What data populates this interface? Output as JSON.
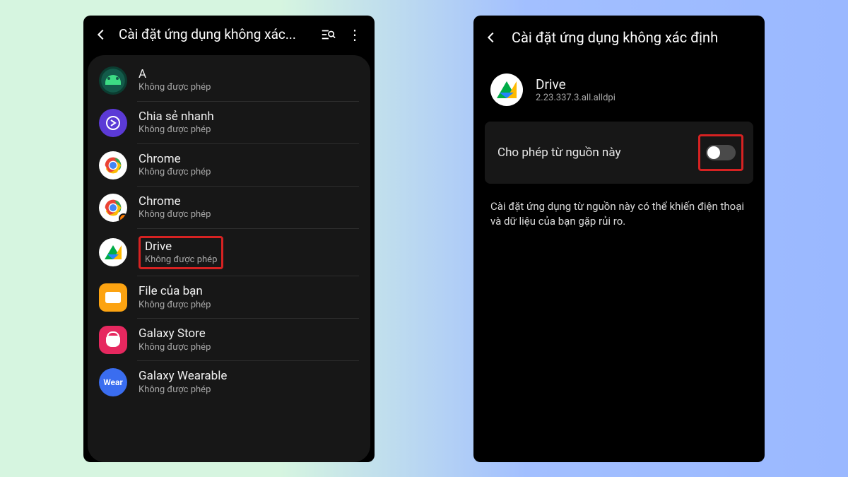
{
  "left": {
    "title": "Cài đặt ứng dụng không xác...",
    "status_denied": "Không được phép",
    "apps": [
      {
        "name": "A"
      },
      {
        "name": "Chia sẻ nhanh"
      },
      {
        "name": "Chrome"
      },
      {
        "name": "Chrome"
      },
      {
        "name": "Drive"
      },
      {
        "name": "File của bạn"
      },
      {
        "name": "Galaxy Store"
      },
      {
        "name": "Galaxy Wearable"
      }
    ],
    "wear_label": "Wear"
  },
  "right": {
    "title": "Cài đặt ứng dụng không xác định",
    "app_name": "Drive",
    "app_version": "2.23.337.3.all.alldpi",
    "toggle_label": "Cho phép từ nguồn này",
    "desc": "Cài đặt ứng dụng từ nguồn này có thể khiến điện thoại và dữ liệu của bạn gặp rủi ro."
  }
}
